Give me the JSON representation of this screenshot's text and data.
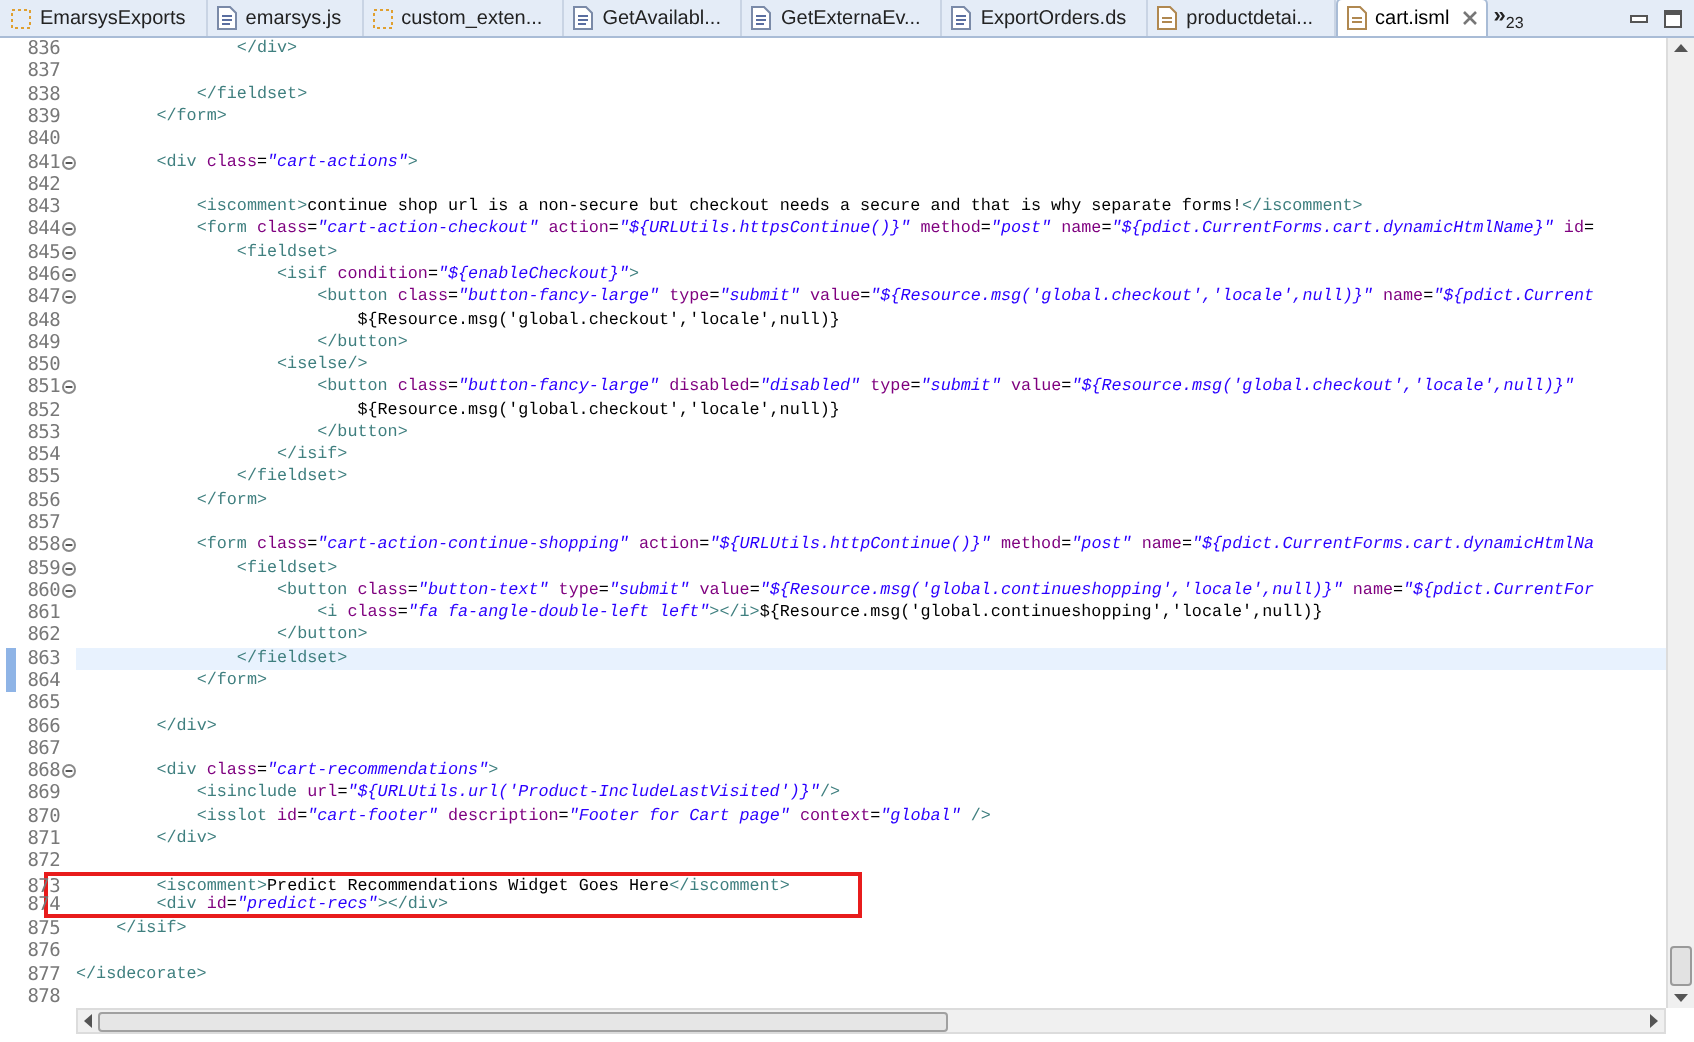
{
  "tabs": [
    {
      "label": "EmarsysExports",
      "kind": "project",
      "selected": false
    },
    {
      "label": "emarsys.js",
      "kind": "script",
      "selected": false
    },
    {
      "label": "custom_exten...",
      "kind": "project",
      "selected": false
    },
    {
      "label": "GetAvailabl...",
      "kind": "script",
      "selected": false
    },
    {
      "label": "GetExternaEv...",
      "kind": "script",
      "selected": false
    },
    {
      "label": "ExportOrders.ds",
      "kind": "script",
      "selected": false
    },
    {
      "label": "productdetai...",
      "kind": "template",
      "selected": false
    },
    {
      "label": "cart.isml",
      "kind": "template",
      "selected": true
    }
  ],
  "overflow": {
    "label": "»",
    "count": "23"
  },
  "lines": [
    {
      "number": "836",
      "text": "                </div>",
      "selected": false,
      "foldable": false,
      "marked": false,
      "boxed": false
    },
    {
      "number": "837",
      "selected": false,
      "foldable": false,
      "marked": false,
      "boxed": false
    },
    {
      "number": "838",
      "text": "            </fieldset>",
      "selected": false,
      "foldable": false,
      "marked": false,
      "boxed": false
    },
    {
      "number": "839",
      "text": "        </form>",
      "selected": false,
      "foldable": false,
      "marked": false,
      "boxed": false
    },
    {
      "number": "840",
      "selected": false,
      "foldable": false,
      "marked": false,
      "boxed": false
    },
    {
      "number": "841",
      "text": "        <div class=\"cart-actions\">",
      "selected": false,
      "foldable": true,
      "marked": false,
      "boxed": false
    },
    {
      "number": "842",
      "selected": false,
      "foldable": false,
      "marked": false,
      "boxed": false
    },
    {
      "number": "843",
      "text": "            <iscomment>continue shop url is a non-secure but checkout needs a secure and that is why separate forms!</iscomment>",
      "selected": false,
      "foldable": false,
      "marked": false,
      "boxed": false
    },
    {
      "number": "844",
      "text": "            <form class=\"cart-action-checkout\" action=\"${URLUtils.httpsContinue()}\" method=\"post\" name=\"${pdict.CurrentForms.cart.dynamicHtmlName}\" id=",
      "selected": false,
      "foldable": true,
      "marked": false,
      "boxed": false
    },
    {
      "number": "845",
      "text": "                <fieldset>",
      "selected": false,
      "foldable": true,
      "marked": false,
      "boxed": false
    },
    {
      "number": "846",
      "text": "                    <isif condition=\"${enableCheckout}\">",
      "selected": false,
      "foldable": true,
      "marked": false,
      "boxed": false
    },
    {
      "number": "847",
      "text": "                        <button class=\"button-fancy-large\" type=\"submit\" value=\"${Resource.msg('global.checkout','locale',null)}\" name=\"${pdict.Current",
      "selected": false,
      "foldable": true,
      "marked": false,
      "boxed": false
    },
    {
      "number": "848",
      "text": "                            ${Resource.msg('global.checkout','locale',null)}",
      "selected": false,
      "foldable": false,
      "marked": false,
      "boxed": false
    },
    {
      "number": "849",
      "text": "                        </button>",
      "selected": false,
      "foldable": false,
      "marked": false,
      "boxed": false
    },
    {
      "number": "850",
      "text": "                    <iselse/>",
      "selected": false,
      "foldable": false,
      "marked": false,
      "boxed": false
    },
    {
      "number": "851",
      "text": "                        <button class=\"button-fancy-large\" disabled=\"disabled\" type=\"submit\" value=\"${Resource.msg('global.checkout','locale',null)}\"",
      "selected": false,
      "foldable": true,
      "marked": false,
      "boxed": false
    },
    {
      "number": "852",
      "text": "                            ${Resource.msg('global.checkout','locale',null)}",
      "selected": false,
      "foldable": false,
      "marked": false,
      "boxed": false
    },
    {
      "number": "853",
      "text": "                        </button>",
      "selected": false,
      "foldable": false,
      "marked": false,
      "boxed": false
    },
    {
      "number": "854",
      "text": "                    </isif>",
      "selected": false,
      "foldable": false,
      "marked": false,
      "boxed": false
    },
    {
      "number": "855",
      "text": "                </fieldset>",
      "selected": false,
      "foldable": false,
      "marked": false,
      "boxed": false
    },
    {
      "number": "856",
      "text": "            </form>",
      "selected": false,
      "foldable": false,
      "marked": false,
      "boxed": false
    },
    {
      "number": "857",
      "selected": false,
      "foldable": false,
      "marked": false,
      "boxed": false
    },
    {
      "number": "858",
      "text": "            <form class=\"cart-action-continue-shopping\" action=\"${URLUtils.httpContinue()}\" method=\"post\" name=\"${pdict.CurrentForms.cart.dynamicHtmlNa",
      "selected": false,
      "foldable": true,
      "marked": false,
      "boxed": false
    },
    {
      "number": "859",
      "text": "                <fieldset>",
      "selected": false,
      "foldable": true,
      "marked": false,
      "boxed": false
    },
    {
      "number": "860",
      "text": "                    <button class=\"button-text\" type=\"submit\" value=\"${Resource.msg('global.continueshopping','locale',null)}\" name=\"${pdict.CurrentFor",
      "selected": false,
      "foldable": true,
      "marked": false,
      "boxed": false
    },
    {
      "number": "861",
      "text": "                        <i class=\"fa fa-angle-double-left left\"></i>${Resource.msg('global.continueshopping','locale',null)}",
      "selected": false,
      "foldable": false,
      "marked": false,
      "boxed": false
    },
    {
      "number": "862",
      "text": "                    </button>",
      "selected": false,
      "foldable": false,
      "marked": false,
      "boxed": false
    },
    {
      "number": "863",
      "text": "                </fieldset>",
      "selected": true,
      "foldable": false,
      "marked": true,
      "boxed": false
    },
    {
      "number": "864",
      "text": "            </form>",
      "selected": false,
      "foldable": false,
      "marked": true,
      "boxed": false
    },
    {
      "number": "865",
      "selected": false,
      "foldable": false,
      "marked": false,
      "boxed": false
    },
    {
      "number": "866",
      "text": "        </div>",
      "selected": false,
      "foldable": false,
      "marked": false,
      "boxed": false
    },
    {
      "number": "867",
      "selected": false,
      "foldable": false,
      "marked": false,
      "boxed": false
    },
    {
      "number": "868",
      "text": "        <div class=\"cart-recommendations\">",
      "selected": false,
      "foldable": true,
      "marked": false,
      "boxed": false
    },
    {
      "number": "869",
      "text": "            <isinclude url=\"${URLUtils.url('Product-IncludeLastVisited')}\"/>",
      "selected": false,
      "foldable": false,
      "marked": false,
      "boxed": false
    },
    {
      "number": "870",
      "text": "            <isslot id=\"cart-footer\" description=\"Footer for Cart page\" context=\"global\" />",
      "selected": false,
      "foldable": false,
      "marked": false,
      "boxed": false
    },
    {
      "number": "871",
      "text": "        </div>",
      "selected": false,
      "foldable": false,
      "marked": false,
      "boxed": false
    },
    {
      "number": "872",
      "selected": false,
      "foldable": false,
      "marked": false,
      "boxed": false
    },
    {
      "number": "873",
      "text": "        <iscomment>Predict Recommendations Widget Goes Here</iscomment>",
      "selected": false,
      "foldable": false,
      "marked": false,
      "boxed": true
    },
    {
      "number": "874",
      "text": "        <div id=\"predict-recs\"></div>",
      "selected": false,
      "foldable": false,
      "marked": false,
      "boxed": true
    },
    {
      "number": "875",
      "text": "    </isif>",
      "selected": false,
      "foldable": false,
      "marked": false,
      "boxed": false
    },
    {
      "number": "876",
      "selected": false,
      "foldable": false,
      "marked": false,
      "boxed": false
    },
    {
      "number": "877",
      "text": "</isdecorate>",
      "selected": false,
      "foldable": false,
      "marked": false,
      "boxed": false
    },
    {
      "number": "878",
      "selected": false,
      "foldable": false,
      "marked": false,
      "boxed": false
    }
  ]
}
